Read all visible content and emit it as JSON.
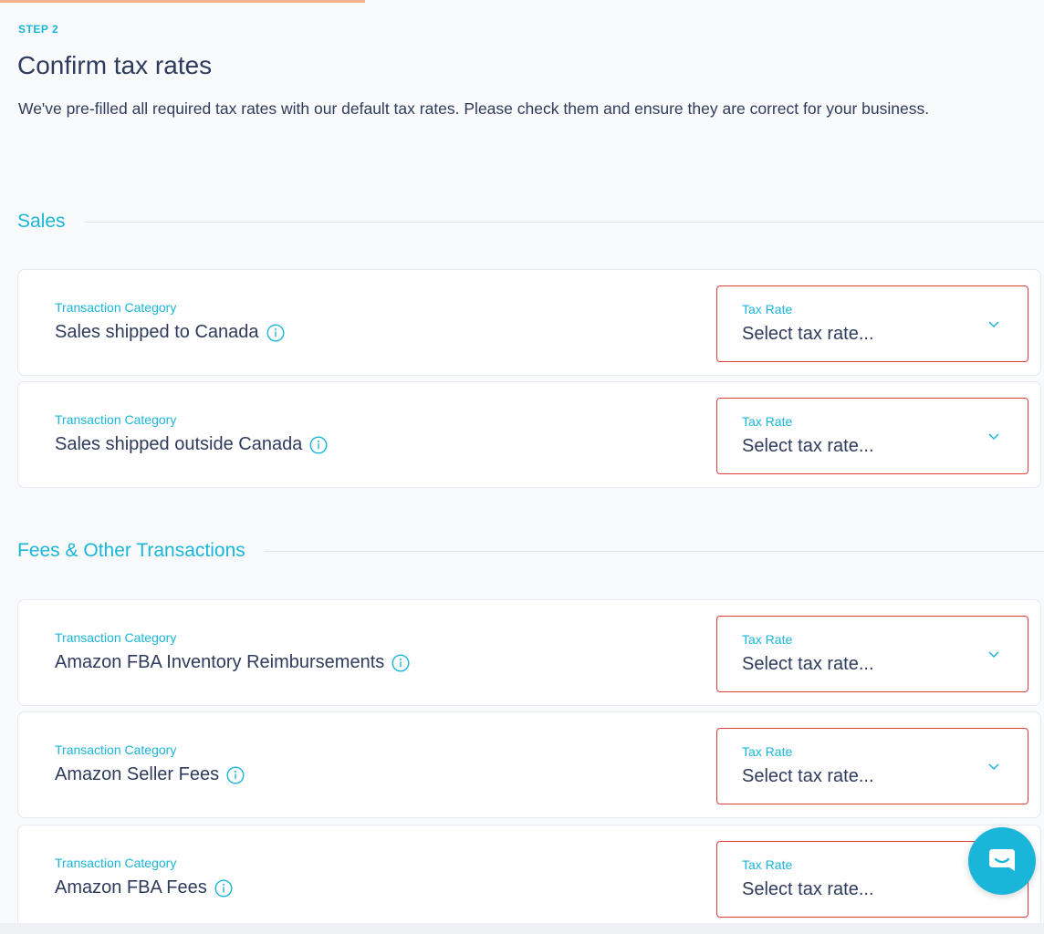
{
  "step_label": "STEP 2",
  "title": "Confirm tax rates",
  "description": "We've pre-filled all required tax rates with our default tax rates. Please check them and ensure they are correct for your business.",
  "sections": [
    {
      "title": "Sales",
      "rows": [
        {
          "category_label": "Transaction Category",
          "category": "Sales shipped to Canada",
          "tax_label": "Tax Rate",
          "tax_placeholder": "Select tax rate..."
        },
        {
          "category_label": "Transaction Category",
          "category": "Sales shipped outside Canada",
          "tax_label": "Tax Rate",
          "tax_placeholder": "Select tax rate..."
        }
      ]
    },
    {
      "title": "Fees & Other Transactions",
      "rows": [
        {
          "category_label": "Transaction Category",
          "category": "Amazon FBA Inventory Reimbursements",
          "tax_label": "Tax Rate",
          "tax_placeholder": "Select tax rate..."
        },
        {
          "category_label": "Transaction Category",
          "category": "Amazon Seller Fees",
          "tax_label": "Tax Rate",
          "tax_placeholder": "Select tax rate..."
        },
        {
          "category_label": "Transaction Category",
          "category": "Amazon FBA Fees",
          "tax_label": "Tax Rate",
          "tax_placeholder": "Select tax rate..."
        }
      ]
    }
  ],
  "icons": {
    "info": "info-circle-icon",
    "dropdown": "chevron-down-icon",
    "chat": "chat-bubble-icon"
  },
  "colors": {
    "accent": "#1ab6d9",
    "text": "#2f3b5c",
    "error_border": "#e33a3a",
    "progress": "#f4b389"
  }
}
